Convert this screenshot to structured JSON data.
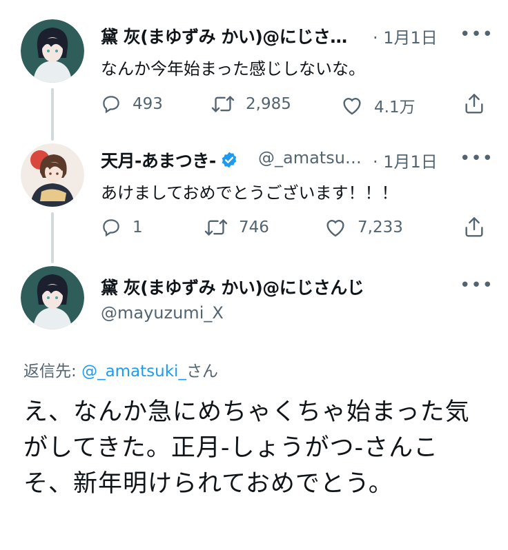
{
  "tweets": [
    {
      "name": "黛 灰(まゆずみ かい)@にじさ…",
      "time": "· 1月1日",
      "text": "なんか今年始まった感じしないな。",
      "reply_count": "493",
      "retweet_count": "2,985",
      "like_count": "4.1万"
    },
    {
      "name": "天月-あまつき-",
      "handle": "@_amatsu…",
      "time": "· 1月1日",
      "text": "あけましておめでとうございます！！！",
      "reply_count": "1",
      "retweet_count": "746",
      "like_count": "7,233",
      "verified": true
    }
  ],
  "main_tweet": {
    "name": "黛 灰(まゆずみ かい)@にじさんじ",
    "handle": "@mayuzumi_X",
    "reply_label": "返信先:",
    "reply_target": "@_amatsuki_",
    "reply_suffix": "さん",
    "text": "え、なんか急にめちゃくちゃ始まった気がしてきた。正月-しょうがつ-さんこそ、新年明けられておめでとう。"
  },
  "icons": {
    "more": "more-dots-icon",
    "reply": "reply-bubble-icon",
    "retweet": "retweet-arrows-icon",
    "like": "heart-icon",
    "share": "share-upload-icon",
    "verified": "verified-badge-icon"
  },
  "colors": {
    "accent": "#1d9bf0",
    "text": "#0f1419",
    "secondary": "#536471",
    "thread_line": "#cfd9de"
  },
  "more_label": "•••"
}
